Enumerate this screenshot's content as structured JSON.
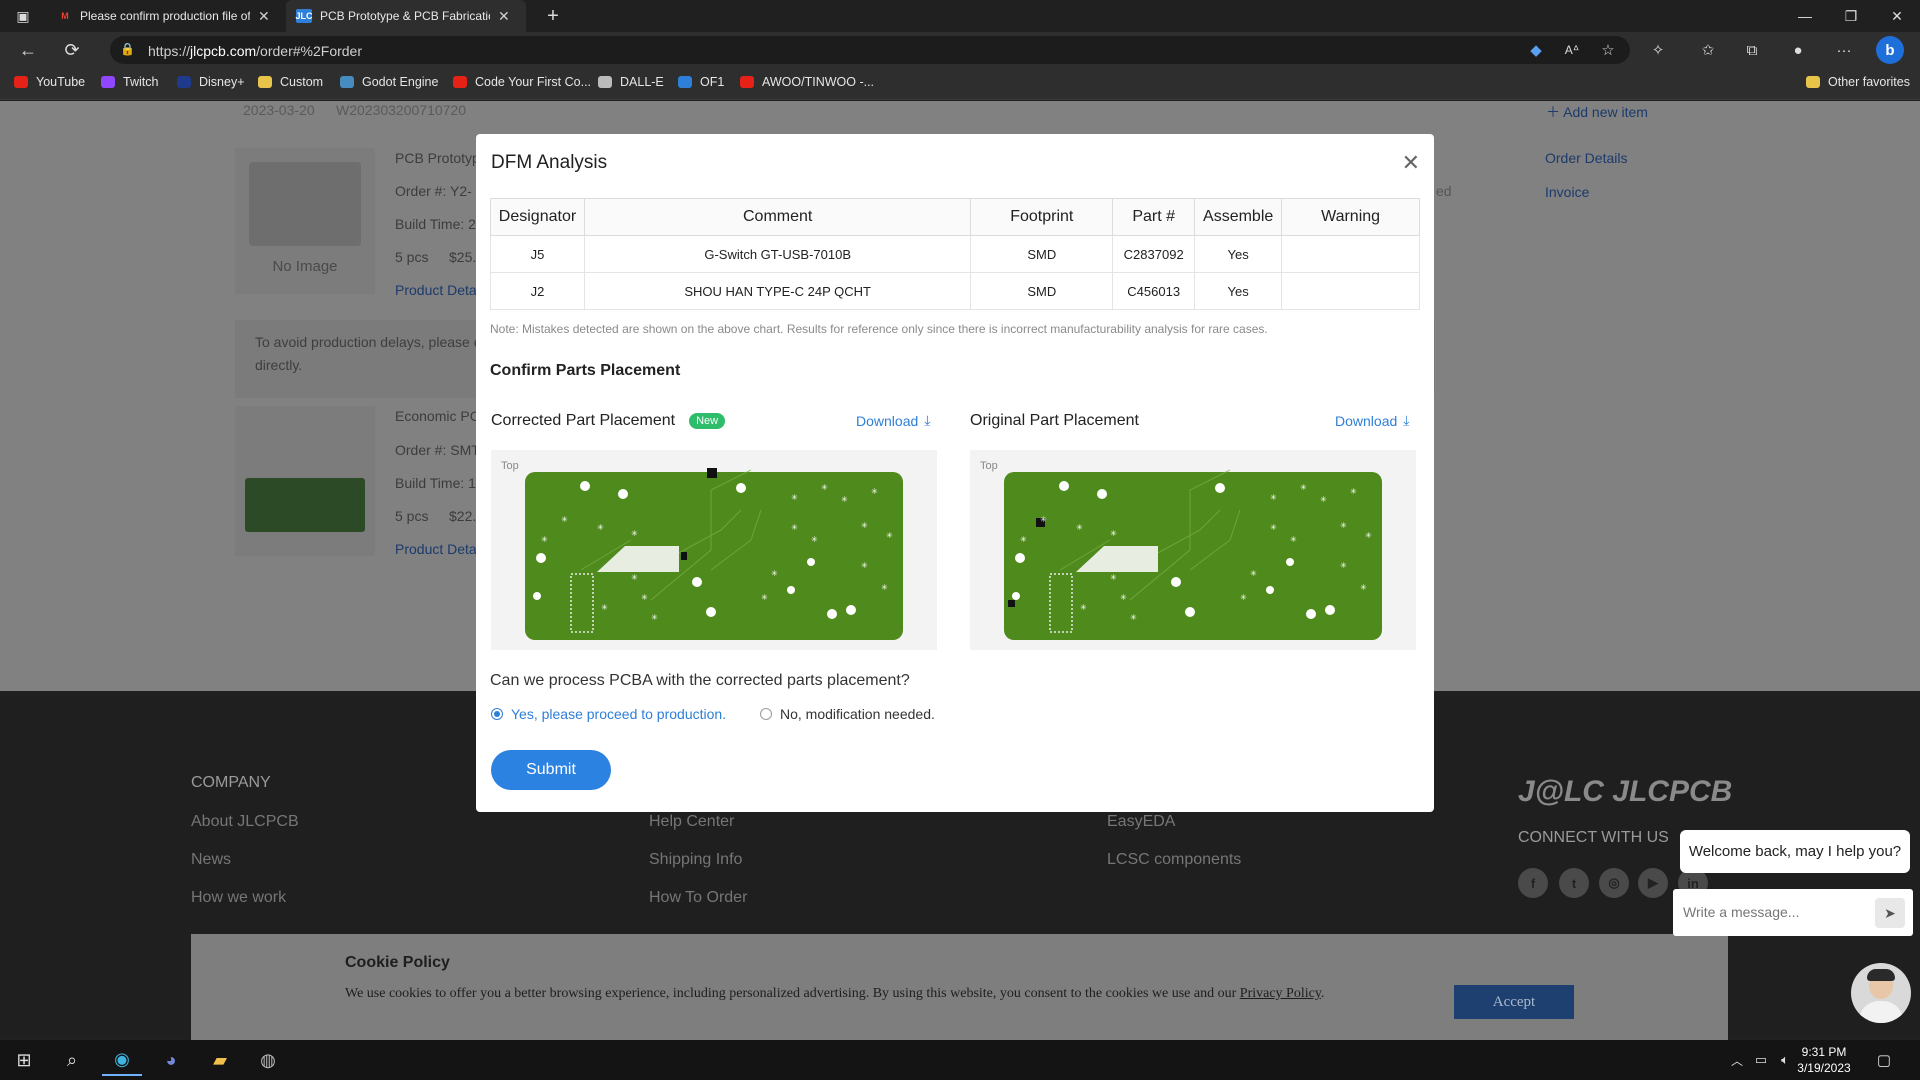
{
  "browser": {
    "tabs": [
      {
        "title": "Please confirm production file of",
        "icon": "gmail-icon"
      },
      {
        "title": "PCB Prototype & PCB Fabrication",
        "icon": "jlc-icon",
        "favicon_text": "JLC"
      }
    ],
    "url_prefix": "https://",
    "url_host": "jlcpcb.com",
    "url_path": "/order#%2Forder",
    "bookmarks": [
      {
        "label": "YouTube",
        "color": "#e62117"
      },
      {
        "label": "Twitch",
        "color": "#9146ff"
      },
      {
        "label": "Disney+",
        "color": "#1f3a8a"
      },
      {
        "label": "Custom",
        "color": "#e8c44a"
      },
      {
        "label": "Godot Engine",
        "color": "#478cbf"
      },
      {
        "label": "Code Your First Co...",
        "color": "#e62117"
      },
      {
        "label": "DALL-E",
        "color": "#bbbbbb"
      },
      {
        "label": "OF1",
        "color": "#2d7fd7"
      },
      {
        "label": "AWOO/TINWOO -...",
        "color": "#e62117"
      }
    ],
    "other_favorites": "Other favorites"
  },
  "page": {
    "date": "2023-03-20",
    "order_id": "W202303200710720",
    "add_item": "Add new item",
    "orders": [
      {
        "name": "PCB Prototyp",
        "order_no": "Order #: Y2-",
        "build": "Build Time: 2",
        "qty": "5 pcs",
        "price": "$25.",
        "details": "Product Deta",
        "no_image": "No Image"
      },
      {
        "name": "Economic PC",
        "order_no": "Order #: SMT",
        "build": "Build Time: 1",
        "qty": "5 pcs",
        "price": "$22.",
        "details": "Product Deta"
      }
    ],
    "side_links": [
      "Order Details",
      "Invoice"
    ],
    "side_status": "ed",
    "notice_line1": "To avoid production delays, please c",
    "notice_line2": "directly."
  },
  "footer": {
    "company_heading": "COMPANY",
    "company_links": [
      "About JLCPCB",
      "News",
      "How we work"
    ],
    "help_links": [
      "Help Center",
      "Shipping Info",
      "How To Order"
    ],
    "tool_links": [
      "EasyEDA",
      "LCSC components"
    ],
    "brand": "JLCPCB",
    "connect": "CONNECT WITH US",
    "social": [
      "facebook-icon",
      "twitter-icon",
      "instagram-icon",
      "youtube-icon",
      "linkedin-icon"
    ]
  },
  "cookie": {
    "title": "Cookie Policy",
    "text": "We use cookies to offer you a better browsing experience, including personalized advertising. By using this website, you consent to the cookies we use and our",
    "link": "Privacy Policy",
    "accept": "Accept"
  },
  "modal": {
    "title": "DFM Analysis",
    "columns": [
      "Designator",
      "Comment",
      "Footprint",
      "Part #",
      "Assemble",
      "Warning"
    ],
    "rows": [
      [
        "J5",
        "G-Switch GT-USB-7010B",
        "SMD",
        "C2837092",
        "Yes",
        ""
      ],
      [
        "J2",
        "SHOU HAN TYPE-C 24P QCHT",
        "SMD",
        "C456013",
        "Yes",
        ""
      ]
    ],
    "note": "Note: Mistakes detected are shown on the above chart. Results for reference only since there is incorrect manufacturability analysis for rare cases.",
    "section_title": "Confirm Parts Placement",
    "corrected_label": "Corrected Part Placement",
    "new_badge": "New",
    "original_label": "Original Part Placement",
    "download": "Download",
    "board_side": "Top",
    "question": "Can we process PCBA with the corrected parts placement?",
    "option_yes": "Yes, please proceed to production.",
    "option_no": "No, modification needed.",
    "selected": "yes",
    "submit": "Submit"
  },
  "chat": {
    "greeting": "Welcome back, may I help you?",
    "placeholder": "Write a message..."
  },
  "taskbar": {
    "time": "9:31 PM",
    "date": "3/19/2023"
  },
  "colors": {
    "accent": "#2d7fd7",
    "submit": "#2c82e0",
    "new_badge": "#2ebd6b",
    "pcb_green": "#4f8a1c"
  }
}
